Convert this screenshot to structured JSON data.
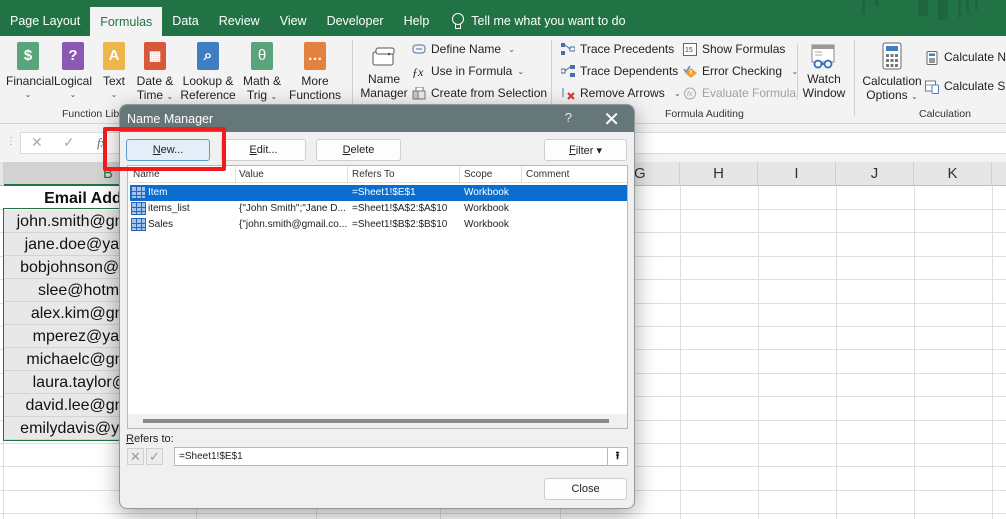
{
  "tabs": [
    {
      "label": "Page Layout",
      "active": false
    },
    {
      "label": "Formulas",
      "active": true
    },
    {
      "label": "Data",
      "active": false
    },
    {
      "label": "Review",
      "active": false
    },
    {
      "label": "View",
      "active": false
    },
    {
      "label": "Developer",
      "active": false
    },
    {
      "label": "Help",
      "active": false
    }
  ],
  "tell_me": "Tell me what you want to do",
  "colors": {
    "excel_green": "#217346",
    "dialog_title": "#667779",
    "selection_blue": "#0a6ed1",
    "highlight_red": "#ee1c1c"
  },
  "ribbon": {
    "function_library": {
      "label": "Function Libr",
      "buttons": [
        {
          "line1": "Financial",
          "line2": "",
          "color": "#5aa47c",
          "glyph": "$"
        },
        {
          "line1": "Logical",
          "line2": "",
          "color": "#8b58b4",
          "glyph": "?"
        },
        {
          "line1": "Text",
          "line2": "",
          "color": "#eeb54a",
          "glyph": "A"
        },
        {
          "line1": "Date &",
          "line2": "Time",
          "color": "#d9573b",
          "glyph": "▦"
        },
        {
          "line1": "Lookup &",
          "line2": "Reference",
          "color": "#3f7ec0",
          "glyph": "⌕"
        },
        {
          "line1": "Math &",
          "line2": "Trig",
          "color": "#5aa47c",
          "glyph": "θ"
        },
        {
          "line1": "More",
          "line2": "Functions",
          "color": "#e2823e",
          "glyph": "…"
        }
      ]
    },
    "defined_names": {
      "name_manager": {
        "line1": "Name",
        "line2": "Manager"
      },
      "define_name": "Define Name",
      "use_in_formula": "Use in Formula",
      "create_from_selection": "Create from Selection"
    },
    "formula_auditing": {
      "label": "Formula Auditing",
      "trace_precedents": "Trace Precedents",
      "trace_dependents": "Trace Dependents",
      "remove_arrows": "Remove Arrows",
      "show_formulas": "Show Formulas",
      "error_checking": "Error Checking",
      "evaluate_formula": "Evaluate Formula",
      "watch_window": {
        "line1": "Watch",
        "line2": "Window"
      }
    },
    "calculation": {
      "label": "Calculation",
      "calc_options": {
        "line1": "Calculation",
        "line2": "Options"
      },
      "calculate_now": "Calculate No",
      "calculate_sheet": "Calculate She"
    }
  },
  "formula_bar": {
    "cancel": "✕",
    "enter": "✓",
    "fx": "fx"
  },
  "grid": {
    "columns_right": [
      "G",
      "H",
      "I",
      "J",
      "K"
    ],
    "column_b": "B",
    "header_cell": "Email Addr",
    "emails": [
      "john.smith@gm",
      "jane.doe@yah",
      "bobjohnson@g",
      "slee@hotma",
      "alex.kim@gm",
      "mperez@yah",
      "michaelc@gm",
      "laura.taylor@",
      "david.lee@gm",
      "emilydavis@ya"
    ]
  },
  "dialog": {
    "title": "Name Manager",
    "help": "?",
    "close_icon": "✕",
    "buttons": {
      "new": {
        "mnemonic": "N",
        "rest": "ew..."
      },
      "edit": {
        "mnemonic": "E",
        "rest": "dit..."
      },
      "delete": {
        "mnemonic": "D",
        "rest": "elete"
      },
      "filter": {
        "mnemonic": "F",
        "rest": "ilter ▾"
      }
    },
    "columns": [
      "Name",
      "Value",
      "Refers To",
      "Scope",
      "Comment"
    ],
    "rows": [
      {
        "name": "Item",
        "value": "",
        "refers_to": "=Sheet1!$E$1",
        "scope": "Workbook",
        "comment": "",
        "selected": true
      },
      {
        "name": "items_list",
        "value": "{\"John Smith\";\"Jane D...",
        "refers_to": "=Sheet1!$A$2:$A$10",
        "scope": "Workbook",
        "comment": "",
        "selected": false
      },
      {
        "name": "Sales",
        "value": "{\"john.smith@gmail.co...",
        "refers_to": "=Sheet1!$B$2:$B$10",
        "scope": "Workbook",
        "comment": "",
        "selected": false
      }
    ],
    "refers_to_label": {
      "mnemonic": "R",
      "rest": "efers to:"
    },
    "refers_to_value": "=Sheet1!$E$1",
    "close_button": "Close"
  }
}
